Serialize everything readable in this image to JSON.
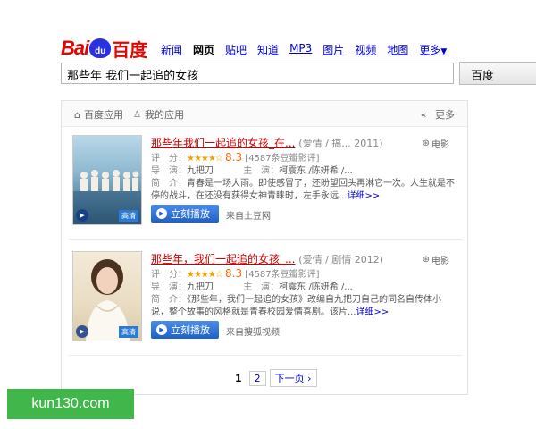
{
  "logo": {
    "bai": "Bai",
    "paw": "du",
    "du": "百度"
  },
  "nav": [
    "新闻",
    "网页",
    "贴吧",
    "知道",
    "MP3",
    "图片",
    "视频",
    "地图",
    "更多"
  ],
  "search": {
    "value": "那些年 我们一起追的女孩",
    "button": "百度"
  },
  "apptabs": {
    "baidu_apps": "百度应用",
    "my_apps": "我的应用",
    "more": "更多"
  },
  "results": [
    {
      "title": "那些年我们一起追的女孩_在...",
      "meta": "(爱情 / 搞... 2011)",
      "type": "电影",
      "rating_label": "评　分：",
      "stars": "★★★★☆",
      "score": "8.3",
      "count": "[4587条豆瓣影评]",
      "director_label": "导　演：",
      "director": "九把刀",
      "actor_label": "主　演：",
      "actors": "柯震东 /陈妍希 /...",
      "intro_label": "简　介：",
      "intro1": "青春是一场大雨。即使感冒了，还盼望回头再淋它一次。人生就是不",
      "intro2": "停的战斗，在还没有获得女神青睐时，左手永远...",
      "detail": "详细>>",
      "play": "立刻播放",
      "source": "来自土豆网",
      "hd": "高清"
    },
    {
      "title": "那些年，我们一起追的女孩_...",
      "meta": "(爱情 / 剧情 2012)",
      "type": "电影",
      "rating_label": "评　分：",
      "stars": "★★★★☆",
      "score": "8.3",
      "count": "[4587条豆瓣影评]",
      "director_label": "导　演：",
      "director": "九把刀",
      "actor_label": "主　演：",
      "actors": "柯震东 /陈妍希 /...",
      "intro_label": "简　介：",
      "intro1": "《那些年，我们一起追的女孩》改编自九把刀自己的同名自传体小",
      "intro2": "说，整个故事的风格就是青春校园爱情喜剧。该片...",
      "detail": "详细>>",
      "play": "立刻播放",
      "source": "来自搜狐视频",
      "hd": "高清"
    }
  ],
  "pager": {
    "p1": "1",
    "p2": "2",
    "next": "下一页 ›"
  },
  "watermark": "kun130.com",
  "colors": {
    "brand_red": "#e10602",
    "brand_blue": "#2932e1",
    "link": "#0000cc",
    "title_red": "#cc0000",
    "play_blue": "#1e60c8",
    "watermark_green": "#41b74b"
  }
}
